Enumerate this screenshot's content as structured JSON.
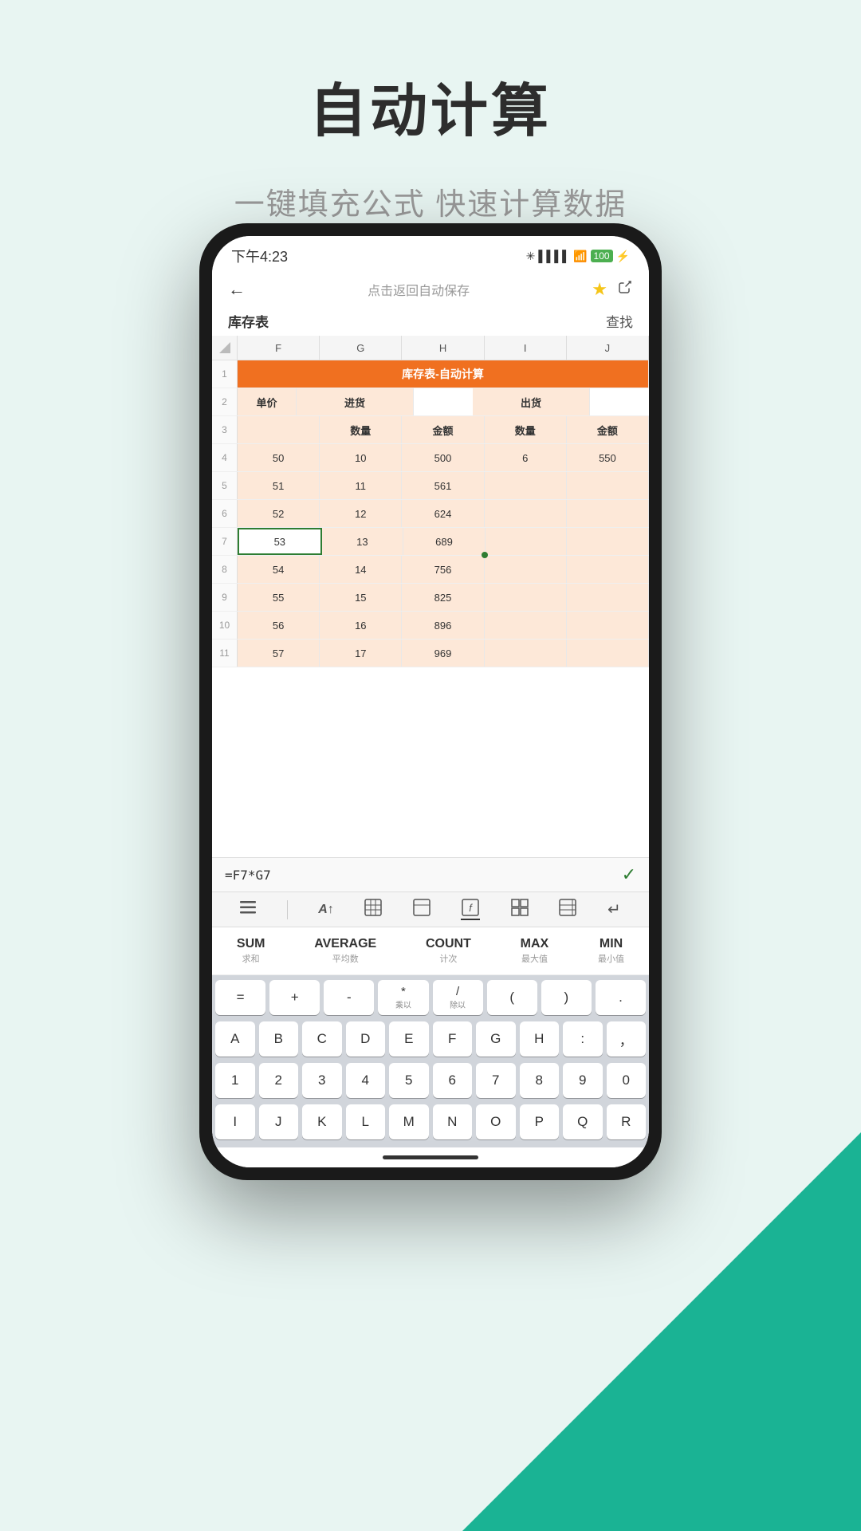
{
  "page": {
    "title": "自动计算",
    "subtitle": "一键填充公式 快速计算数据"
  },
  "status_bar": {
    "time": "下午4:23",
    "icons": "🔔 ⏰ 📱 ✳ * ▌▌▌▌▌ 📶 🔋"
  },
  "top_nav": {
    "back": "←",
    "title": "点击返回自动保存",
    "star": "★",
    "share": "⤴"
  },
  "sheet": {
    "name": "库存表",
    "find": "查找"
  },
  "columns": [
    "F",
    "G",
    "H",
    "I",
    "J"
  ],
  "merged_title": "库存表-自动计算",
  "row2_headers": [
    "单价",
    "进货",
    "",
    "出货",
    ""
  ],
  "row3_headers": [
    "",
    "数量",
    "金额",
    "数量",
    "金额"
  ],
  "data_rows": [
    {
      "row": "4",
      "cells": [
        "50",
        "10",
        "500",
        "6",
        "550"
      ],
      "highlight": true
    },
    {
      "row": "5",
      "cells": [
        "51",
        "11",
        "561",
        "",
        ""
      ],
      "highlight": true
    },
    {
      "row": "6",
      "cells": [
        "52",
        "12",
        "624",
        "",
        ""
      ],
      "highlight": true
    },
    {
      "row": "7",
      "cells": [
        "53",
        "13",
        "689",
        "",
        ""
      ],
      "highlight": false,
      "selected_col": 0
    },
    {
      "row": "8",
      "cells": [
        "54",
        "14",
        "756",
        "",
        ""
      ],
      "highlight": true
    },
    {
      "row": "9",
      "cells": [
        "55",
        "15",
        "825",
        "",
        ""
      ],
      "highlight": true
    },
    {
      "row": "10",
      "cells": [
        "56",
        "16",
        "896",
        "",
        ""
      ],
      "highlight": true
    },
    {
      "row": "11",
      "cells": [
        "57",
        "17",
        "969",
        "",
        ""
      ],
      "highlight": true
    }
  ],
  "formula_bar": {
    "text": "=F7*G7",
    "confirm": "✓"
  },
  "toolbar_icons": [
    "☰",
    "|",
    "A↑",
    "⊞",
    "⊟",
    "⊘",
    "⊞⊞",
    "⊟⊟",
    "↵"
  ],
  "functions": [
    {
      "main": "SUM",
      "sub": "求和"
    },
    {
      "main": "AVERAGE",
      "sub": "平均数"
    },
    {
      "main": "COUNT",
      "sub": "计次"
    },
    {
      "main": "MAX",
      "sub": "最大值"
    },
    {
      "main": "MIN",
      "sub": "最小值"
    }
  ],
  "keyboard": {
    "operator_row": [
      {
        "top": "=",
        "bottom": ""
      },
      {
        "top": "+",
        "bottom": ""
      },
      {
        "top": "-",
        "bottom": ""
      },
      {
        "top": "*",
        "bottom": "乘以"
      },
      {
        "top": "/",
        "bottom": "除以"
      },
      {
        "top": "(",
        "bottom": ""
      },
      {
        "top": ")",
        "bottom": ""
      },
      {
        "top": ".",
        "bottom": ""
      }
    ],
    "letter_row1": [
      "A",
      "B",
      "C",
      "D",
      "E",
      "F",
      "G",
      "H",
      ":",
      "，"
    ],
    "letter_row2": [
      "1",
      "2",
      "3",
      "4",
      "5",
      "6",
      "7",
      "8",
      "9",
      "0"
    ],
    "letter_row3": [
      "I",
      "J",
      "K",
      "L",
      "M",
      "N",
      "O",
      "P",
      "Q",
      "R"
    ]
  }
}
